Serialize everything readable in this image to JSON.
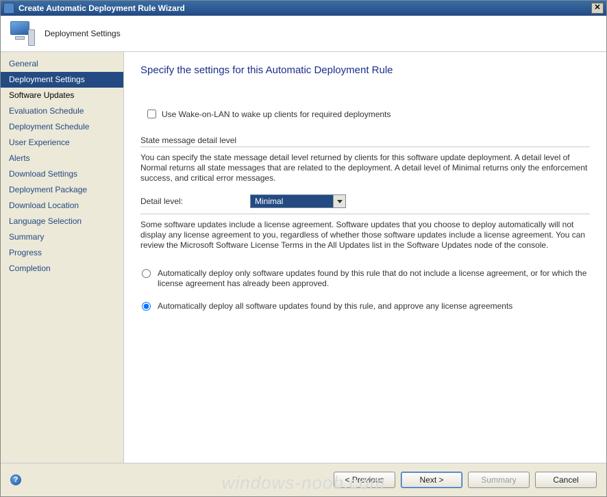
{
  "window": {
    "title": "Create Automatic Deployment Rule Wizard"
  },
  "header": {
    "title": "Deployment Settings"
  },
  "sidebar": {
    "items": [
      {
        "label": "General"
      },
      {
        "label": "Deployment Settings"
      },
      {
        "label": "Software Updates"
      },
      {
        "label": "Evaluation Schedule"
      },
      {
        "label": "Deployment Schedule"
      },
      {
        "label": "User Experience"
      },
      {
        "label": "Alerts"
      },
      {
        "label": "Download Settings"
      },
      {
        "label": "Deployment Package"
      },
      {
        "label": "Download Location"
      },
      {
        "label": "Language Selection"
      },
      {
        "label": "Summary"
      },
      {
        "label": "Progress"
      },
      {
        "label": "Completion"
      }
    ],
    "selectedIndex": 1
  },
  "content": {
    "page_title": "Specify the settings for this Automatic Deployment Rule",
    "wol_label": "Use Wake-on-LAN to wake up clients for required deployments",
    "wol_checked": false,
    "state_section_label": "State message detail level",
    "state_section_desc": "You can specify the state message detail level returned by clients for this software update deployment.  A detail level of Normal returns all state messages that are related to the deployment.  A detail level of Minimal returns only the enforcement success, and critical error messages.",
    "detail_label": "Detail level:",
    "detail_value": "Minimal",
    "license_desc": "Some software updates include a license agreement.  Software updates that you choose to deploy automatically will not display any license agreement to you, regardless of whether those software updates include a license agreement. You can review the Microsoft Software License Terms in the All Updates list in the Software Updates node of the console.",
    "radio1_label": "Automatically deploy only software updates found by this rule that do not include a license agreement, or for which the license agreement has already been approved.",
    "radio2_label": "Automatically deploy all software updates found by this rule, and approve any license agreements",
    "radio_selected": 2
  },
  "footer": {
    "help_tooltip": "?",
    "prev": "< Previous",
    "next": "Next >",
    "summary": "Summary",
    "cancel": "Cancel"
  },
  "watermark": "windows-noob.com"
}
